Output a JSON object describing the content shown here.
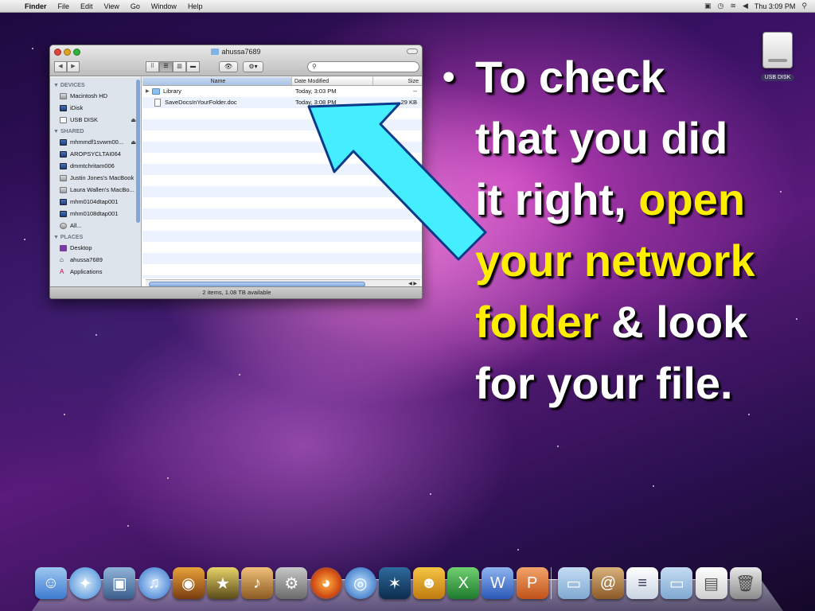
{
  "menubar": {
    "app_name": "Finder",
    "menus": [
      "File",
      "Edit",
      "View",
      "Go",
      "Window",
      "Help"
    ],
    "clock": "Thu 3:09 PM"
  },
  "finder": {
    "title": "ahussa7689",
    "search_placeholder": "",
    "sidebar": {
      "devices_header": "▼ DEVICES",
      "devices": [
        "Macintosh HD",
        "iDisk",
        "USB DISK"
      ],
      "shared_header": "▼ SHARED",
      "shared": [
        "mhmmdf1svwm00...",
        "AROPSYCLTAI064",
        "dmmtchritam006",
        "Justin Jones's MacBook",
        "Laura Wallen's MacBo...",
        "mhm0104dtap001",
        "mhm0108dtap001",
        "All..."
      ],
      "places_header": "▼ PLACES",
      "places": [
        "Desktop",
        "ahussa7689",
        "Applications"
      ]
    },
    "columns": {
      "name": "Name",
      "date": "Date Modified",
      "size": "Size"
    },
    "files": [
      {
        "name": "Library",
        "date": "Today, 3:03 PM",
        "size": "--"
      },
      {
        "name": "SaveDocsInYourFolder.doc",
        "date": "Today, 3:08 PM",
        "size": "29 KB"
      }
    ],
    "status": "2 items, 1.08 TB available"
  },
  "desktop": {
    "usb_label": "USB DISK"
  },
  "slide": {
    "bullet": "•",
    "line1": "To check",
    "line2": "that you did",
    "line3_plain": "it right, ",
    "line3_hl": "open",
    "line4_hl": "your network",
    "line5_hl": "folder",
    "line5_plain": " & look",
    "line6": "for your file."
  },
  "colors": {
    "highlight": "#ffee00",
    "arrow": "#44eeff"
  },
  "dock": [
    "finder-icon",
    "safari-icon",
    "iphoto-icon",
    "itunes-icon",
    "photo-booth-icon",
    "imovie-icon",
    "garageband-icon",
    "system-preferences-icon",
    "firefox-icon",
    "dvd-player-icon",
    "stellarium-icon",
    "smiley-app-icon",
    "excel-icon",
    "word-icon",
    "powerpoint-icon",
    "applications-folder-icon",
    "address-book-icon",
    "documents-icon",
    "downloads-folder-icon",
    "pdf-icon",
    "trash-icon"
  ]
}
